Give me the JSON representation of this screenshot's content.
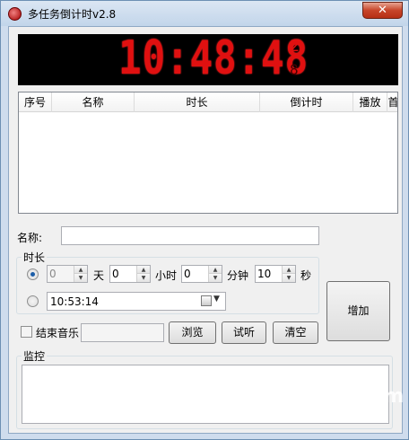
{
  "window": {
    "title": "多任务倒计时v2.8",
    "close_label": "✕"
  },
  "clock": {
    "digits": "10:48:48",
    "small_top": "2",
    "small_bottom": "8"
  },
  "list": {
    "columns": [
      "序号",
      "名称",
      "时长",
      "倒计时",
      "播放",
      "首"
    ]
  },
  "form": {
    "name_label": "名称:",
    "name_value": "",
    "duration_group_title": "时长",
    "days_value": "0",
    "days_unit": "天",
    "hours_value": "0",
    "hours_unit": "小时",
    "minutes_value": "0",
    "minutes_unit": "分钟",
    "seconds_value": "10",
    "seconds_unit": "秒",
    "time_value": "10:53:14",
    "end_music_label": "结束音乐",
    "browse_label": "浏览",
    "listen_label": "试听",
    "clear_label": "清空",
    "add_label": "增加",
    "monitor_label": "监控"
  },
  "watermark": "Yuzo.com"
}
